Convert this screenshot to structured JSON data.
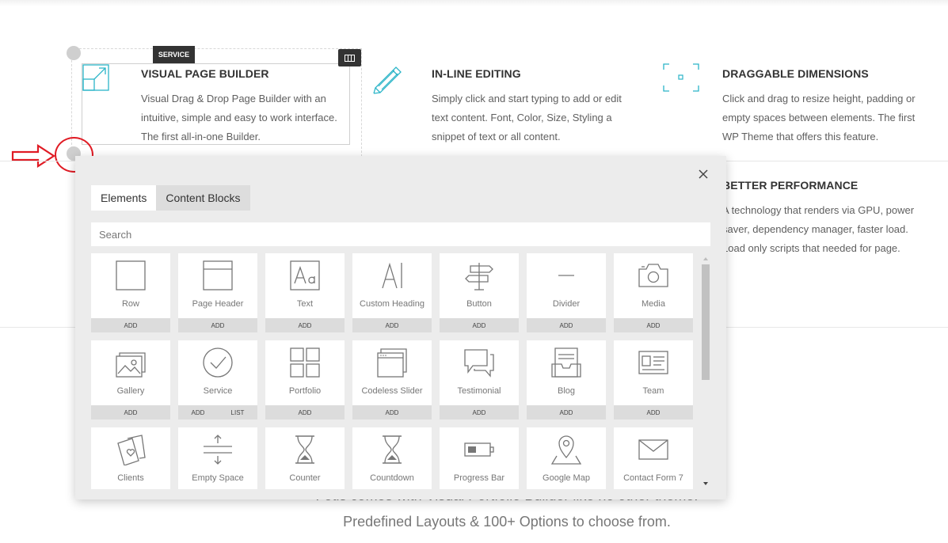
{
  "features": [
    {
      "title": "VISUAL PAGE BUILDER",
      "body": "Visual Drag & Drop Page Builder with an intuitive, simple and easy to work interface. The first all-in-one Builder.",
      "icon": "resize-icon"
    },
    {
      "title": "IN-LINE EDITING",
      "body": "Simply click  and start typing to add or edit text content. Font, Color, Size, Styling a snippet of text or all content.",
      "icon": "pencil-icon"
    },
    {
      "title": "DRAGGABLE DIMENSIONS",
      "body": "Click and drag to resize height, padding or empty spaces between elements. The first WP Theme that offers this feature.",
      "icon": "dimensions-icon"
    },
    {
      "title": "BETTER PERFORMANCE",
      "body": "A technology that renders via GPU, power saver, dependency manager, faster load. Load only scripts that needed for page."
    }
  ],
  "edit_controls": {
    "service_tag": "SERVICE",
    "columns_icon": "columns-icon"
  },
  "bottom_text": {
    "line1": "Fotis comes with Visual Portfolio Builder like no other theme.",
    "line2": "Predefined Layouts & 100+ Options to choose from."
  },
  "modal": {
    "tabs": [
      {
        "label": "Elements",
        "active": true
      },
      {
        "label": "Content Blocks",
        "active": false
      }
    ],
    "search_placeholder": "Search",
    "close_icon": "close-icon",
    "elements": [
      {
        "label": "Row",
        "icon": "row-icon",
        "actions": [
          "ADD"
        ]
      },
      {
        "label": "Page Header",
        "icon": "page-header-icon",
        "actions": [
          "ADD"
        ]
      },
      {
        "label": "Text",
        "icon": "text-icon",
        "actions": [
          "ADD"
        ]
      },
      {
        "label": "Custom Heading",
        "icon": "heading-icon",
        "actions": [
          "ADD"
        ]
      },
      {
        "label": "Button",
        "icon": "signpost-icon",
        "actions": [
          "ADD"
        ]
      },
      {
        "label": "Divider",
        "icon": "divider-icon",
        "actions": [
          "ADD"
        ]
      },
      {
        "label": "Media",
        "icon": "camera-icon",
        "actions": [
          "ADD"
        ]
      },
      {
        "label": "Gallery",
        "icon": "gallery-icon",
        "actions": [
          "ADD"
        ]
      },
      {
        "label": "Service",
        "icon": "check-circle-icon",
        "actions": [
          "ADD",
          "LIST"
        ]
      },
      {
        "label": "Portfolio",
        "icon": "portfolio-grid-icon",
        "actions": [
          "ADD"
        ]
      },
      {
        "label": "Codeless Slider",
        "icon": "slider-icon",
        "actions": [
          "ADD"
        ]
      },
      {
        "label": "Testimonial",
        "icon": "speech-bubbles-icon",
        "actions": [
          "ADD"
        ]
      },
      {
        "label": "Blog",
        "icon": "inbox-icon",
        "actions": [
          "ADD"
        ]
      },
      {
        "label": "Team",
        "icon": "id-card-icon",
        "actions": [
          "ADD"
        ]
      },
      {
        "label": "Clients",
        "icon": "cards-icon",
        "actions": []
      },
      {
        "label": "Empty Space",
        "icon": "vertical-space-icon",
        "actions": []
      },
      {
        "label": "Counter",
        "icon": "hourglass-icon",
        "actions": []
      },
      {
        "label": "Countdown",
        "icon": "hourglass-icon",
        "actions": []
      },
      {
        "label": "Progress Bar",
        "icon": "battery-icon",
        "actions": []
      },
      {
        "label": "Google Map",
        "icon": "map-pin-icon",
        "actions": []
      },
      {
        "label": "Contact Form 7",
        "icon": "envelope-icon",
        "actions": []
      }
    ]
  },
  "colors": {
    "accent": "#2bb5c8",
    "annotation": "#e01b24",
    "dark": "#333333"
  }
}
